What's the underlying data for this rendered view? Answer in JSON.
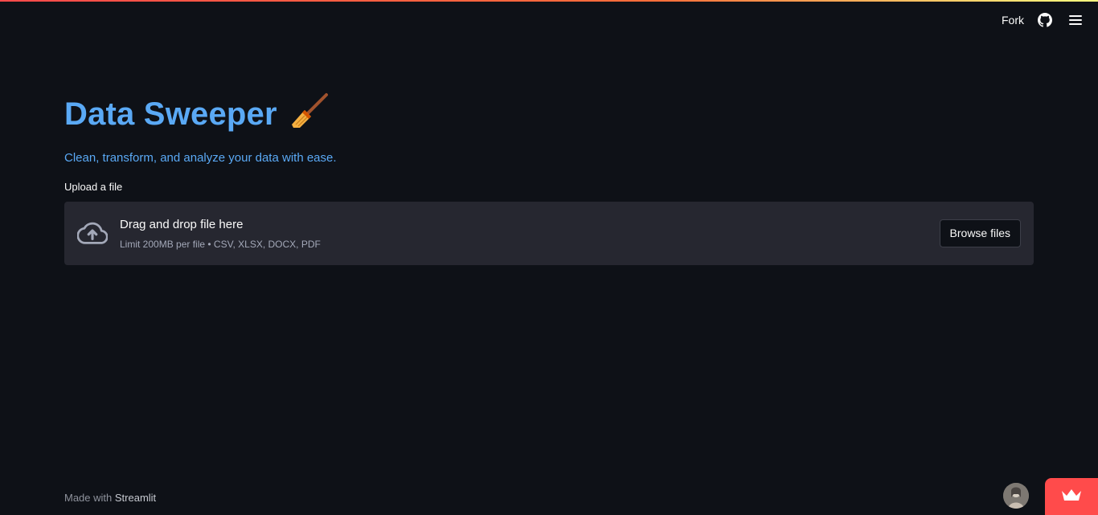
{
  "header": {
    "fork_label": "Fork",
    "github_icon": "github-icon",
    "menu_icon": "hamburger-menu-icon"
  },
  "main": {
    "title": "Data Sweeper",
    "title_emoji": "🧹",
    "subtitle": "Clean, transform, and analyze your data with ease.",
    "upload": {
      "label": "Upload a file",
      "dropzone_title": "Drag and drop file here",
      "dropzone_limit": "Limit 200MB per file • CSV, XLSX, DOCX, PDF",
      "browse_label": "Browse files",
      "icon": "cloud-upload-icon"
    }
  },
  "footer": {
    "made_with": "Made with ",
    "brand": "Streamlit"
  },
  "colors": {
    "background": "#0e1117",
    "accent_blue": "#5aa9f5",
    "dropzone_bg": "#262730",
    "streamlit_red": "#ff4b4b"
  }
}
